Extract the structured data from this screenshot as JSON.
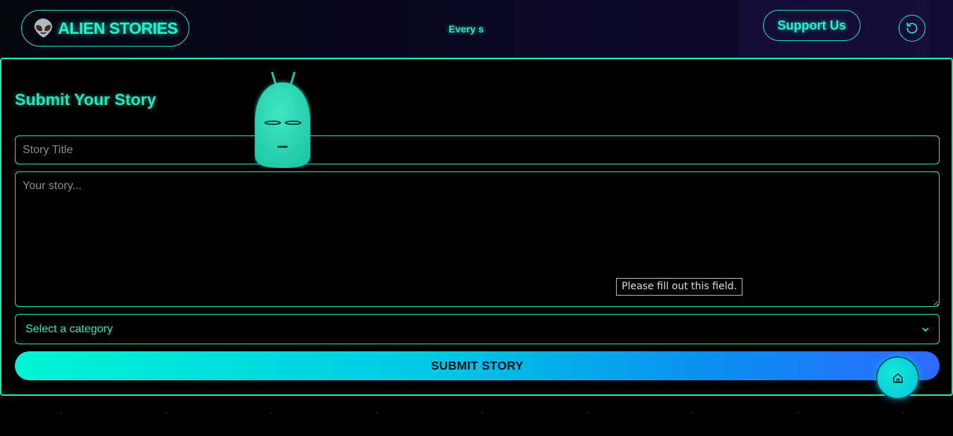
{
  "header": {
    "logo_emoji": "👽",
    "logo_text": "ALIEN STORIES",
    "ticker_text": "Every s",
    "support_label": "Support Us",
    "refresh_icon": "refresh-icon"
  },
  "form": {
    "heading": "Submit Your Story",
    "title_placeholder": "Story Title",
    "story_placeholder": "Your story...",
    "category_selected": "Select a category",
    "submit_label": "SUBMIT STORY",
    "validation_tooltip": "Please fill out this field."
  },
  "fab": {
    "icon": "home-icon"
  },
  "colors": {
    "accent": "#1de9c0",
    "background": "#000000",
    "gradient_end": "#2a6bff"
  }
}
